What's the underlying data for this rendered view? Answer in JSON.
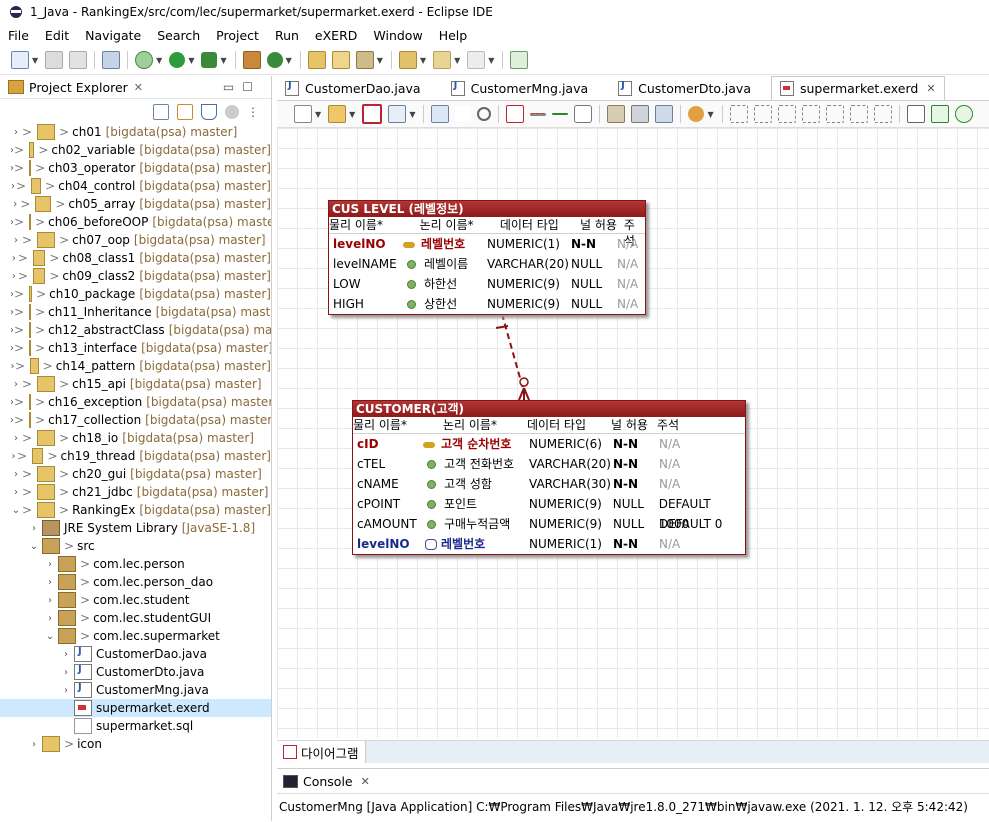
{
  "window": {
    "title": "1_Java - RankingEx/src/com/lec/supermarket/supermarket.exerd - Eclipse IDE"
  },
  "menu": [
    "File",
    "Edit",
    "Navigate",
    "Search",
    "Project",
    "Run",
    "eXERD",
    "Window",
    "Help"
  ],
  "project_explorer": {
    "title": "Project Explorer",
    "items": [
      {
        "label": "ch01",
        "git": "[bigdata(psa) master]"
      },
      {
        "label": "ch02_variable",
        "git": "[bigdata(psa) master]"
      },
      {
        "label": "ch03_operator",
        "git": "[bigdata(psa) master]"
      },
      {
        "label": "ch04_control",
        "git": "[bigdata(psa) master]"
      },
      {
        "label": "ch05_array",
        "git": "[bigdata(psa) master]"
      },
      {
        "label": "ch06_beforeOOP",
        "git": "[bigdata(psa) master]"
      },
      {
        "label": "ch07_oop",
        "git": "[bigdata(psa) master]"
      },
      {
        "label": "ch08_class1",
        "git": "[bigdata(psa) master]"
      },
      {
        "label": "ch09_class2",
        "git": "[bigdata(psa) master]"
      },
      {
        "label": "ch10_package",
        "git": "[bigdata(psa) master]"
      },
      {
        "label": "ch11_Inheritance",
        "git": "[bigdata(psa) master]"
      },
      {
        "label": "ch12_abstractClass",
        "git": "[bigdata(psa) maste"
      },
      {
        "label": "ch13_interface",
        "git": "[bigdata(psa) master]"
      },
      {
        "label": "ch14_pattern",
        "git": "[bigdata(psa) master]"
      },
      {
        "label": "ch15_api",
        "git": "[bigdata(psa) master]"
      },
      {
        "label": "ch16_exception",
        "git": "[bigdata(psa) master]"
      },
      {
        "label": "ch17_collection",
        "git": "[bigdata(psa) master]"
      },
      {
        "label": "ch18_io",
        "git": "[bigdata(psa) master]"
      },
      {
        "label": "ch19_thread",
        "git": "[bigdata(psa) master]"
      },
      {
        "label": "ch20_gui",
        "git": "[bigdata(psa) master]"
      },
      {
        "label": "ch21_jdbc",
        "git": "[bigdata(psa) master]"
      },
      {
        "label": "RankingEx",
        "git": "[bigdata(psa) master]"
      }
    ],
    "jre": {
      "label": "JRE System Library",
      "extra": "[JavaSE-1.8]"
    },
    "src": "src",
    "packages": [
      "com.lec.person",
      "com.lec.person_dao",
      "com.lec.student",
      "com.lec.studentGUI",
      "com.lec.supermarket"
    ],
    "files": [
      "CustomerDao.java",
      "CustomerDto.java",
      "CustomerMng.java",
      "supermarket.exerd",
      "supermarket.sql"
    ],
    "icon_folder": "icon"
  },
  "editor_tabs": [
    "CustomerDao.java",
    "CustomerMng.java",
    "CustomerDto.java",
    "supermarket.exerd"
  ],
  "entities": {
    "cus_level": {
      "title": "CUS LEVEL (레벨정보)",
      "headers": [
        "물리 이름*",
        "논리 이름*",
        "데이터 타입",
        "널 허용",
        "주석"
      ],
      "rows": [
        {
          "phys": "levelNO",
          "logic": "레벨번호",
          "type": "NUMERIC(1)",
          "nullable": "N-N",
          "comment": "N/A"
        },
        {
          "phys": "levelNAME",
          "logic": "레벨이름",
          "type": "VARCHAR(20)",
          "nullable": "NULL",
          "comment": "N/A"
        },
        {
          "phys": "LOW",
          "logic": "하한선",
          "type": "NUMERIC(9)",
          "nullable": "NULL",
          "comment": "N/A"
        },
        {
          "phys": "HIGH",
          "logic": "상한선",
          "type": "NUMERIC(9)",
          "nullable": "NULL",
          "comment": "N/A"
        }
      ]
    },
    "customer": {
      "title": "CUSTOMER(고객)",
      "headers": [
        "물리 이름*",
        "논리 이름*",
        "데이터 타입",
        "널 허용",
        "주석"
      ],
      "rows": [
        {
          "phys": "cID",
          "logic": "고객 순차번호",
          "type": "NUMERIC(6)",
          "nullable": "N-N",
          "comment": "N/A"
        },
        {
          "phys": "cTEL",
          "logic": "고객 전화번호",
          "type": "VARCHAR(20)",
          "nullable": "N-N",
          "comment": "N/A"
        },
        {
          "phys": "cNAME",
          "logic": "고객 성함",
          "type": "VARCHAR(30)",
          "nullable": "N-N",
          "comment": "N/A"
        },
        {
          "phys": "cPOINT",
          "logic": "포인트",
          "type": "NUMERIC(9)",
          "nullable": "NULL",
          "comment": "DEFAULT 1000"
        },
        {
          "phys": "cAMOUNT",
          "logic": "구매누적금액",
          "type": "NUMERIC(9)",
          "nullable": "NULL",
          "comment": "DEFAULT 0"
        },
        {
          "phys": "levelNO",
          "logic": "레벨번호",
          "type": "NUMERIC(1)",
          "nullable": "N-N",
          "comment": "N/A"
        }
      ]
    }
  },
  "diagram_tab": "다이어그램",
  "console": {
    "title": "Console",
    "line": "CustomerMng [Java Application] C:₩Program Files₩Java₩jre1.8.0_271₩bin₩javaw.exe (2021. 1. 12. 오후 5:42:42)"
  }
}
